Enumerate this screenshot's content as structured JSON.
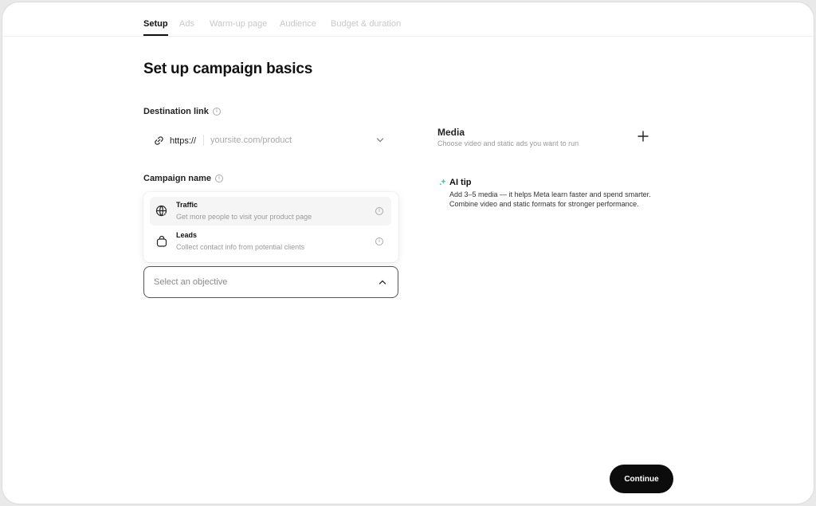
{
  "tabs": [
    "Setup",
    "Ads",
    "Warm-up page",
    "Audience",
    "Budget & duration"
  ],
  "page_title": "Set up campaign basics",
  "destination": {
    "label": "Destination link",
    "protocol": "https://",
    "placeholder": "yoursite.com/product"
  },
  "campaign_name": {
    "label": "Campaign name"
  },
  "objective_menu": {
    "options": [
      {
        "title": "Traffic",
        "description": "Get more people to visit your product page",
        "icon": "globe-cursor-icon"
      },
      {
        "title": "Leads",
        "description": "Collect contact info from potential clients",
        "icon": "bag-icon"
      }
    ]
  },
  "objective_select": {
    "placeholder": "Select an objective"
  },
  "media": {
    "title": "Media",
    "description": "Choose video and static ads you want to run"
  },
  "ai_tip": {
    "title": "AI tip",
    "line1": "Add 3–5 media — it helps Meta learn faster and spend smarter.",
    "line2": "Combine video and static formats for stronger performance."
  },
  "continue_label": "Continue",
  "colors": {
    "primary": "#0c0c0c",
    "accent_ai": "#3fcf8e"
  }
}
